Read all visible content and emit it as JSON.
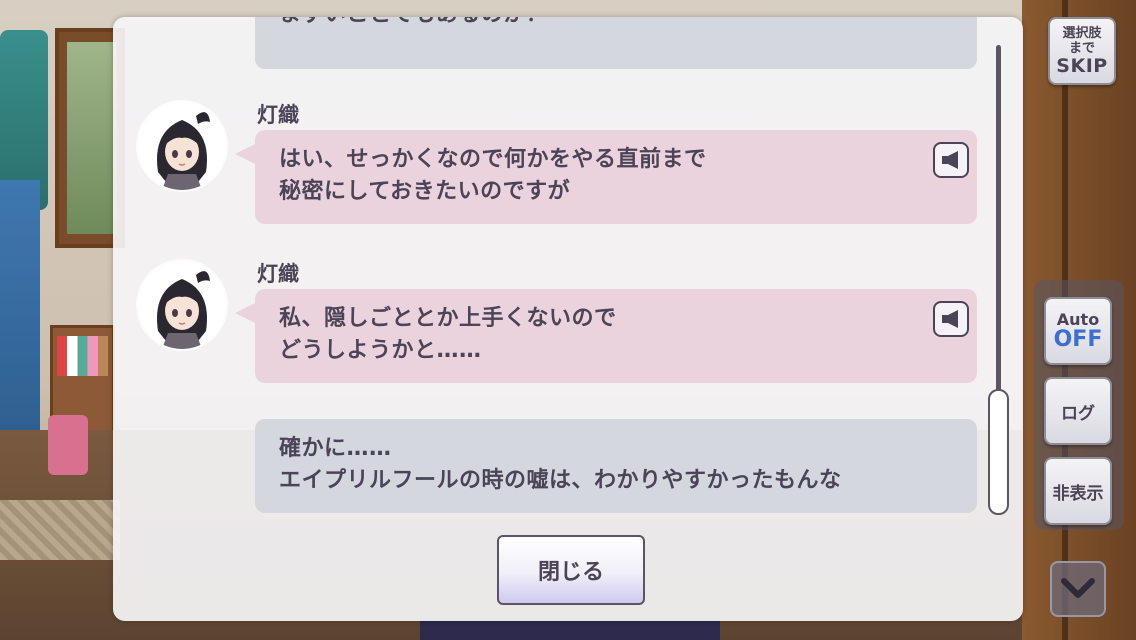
{
  "log": {
    "top_partial_text": "まずいことでもあるのか？",
    "entries": [
      {
        "speaker": "灯織",
        "lines": [
          "はい、せっかくなので何かをやる直前まで",
          "秘密にしておきたいのですが"
        ],
        "has_voice": true
      },
      {
        "speaker": "灯織",
        "lines": [
          "私、隠しごととか上手くないので",
          "どうしようかと……"
        ],
        "has_voice": true
      },
      {
        "speaker": "",
        "lines": [
          "確かに……",
          "エイプリルフールの時の嘘は、わかりやすかったもんな"
        ],
        "has_voice": false
      }
    ],
    "close_label": "閉じる",
    "voice_icon": "speaker-icon"
  },
  "controls": {
    "skip_line1": "選択肢",
    "skip_line2": "まで",
    "skip_line3": "SKIP",
    "auto_label": "Auto",
    "auto_state": "OFF",
    "log_label": "ログ",
    "hide_label": "非表示",
    "menu_icon": "chevron-down-icon"
  },
  "colors": {
    "pink_bubble": "#ebd3de",
    "gray_bubble": "#d4d8de",
    "text": "#4b4456",
    "auto_off": "#3c6fd0"
  }
}
